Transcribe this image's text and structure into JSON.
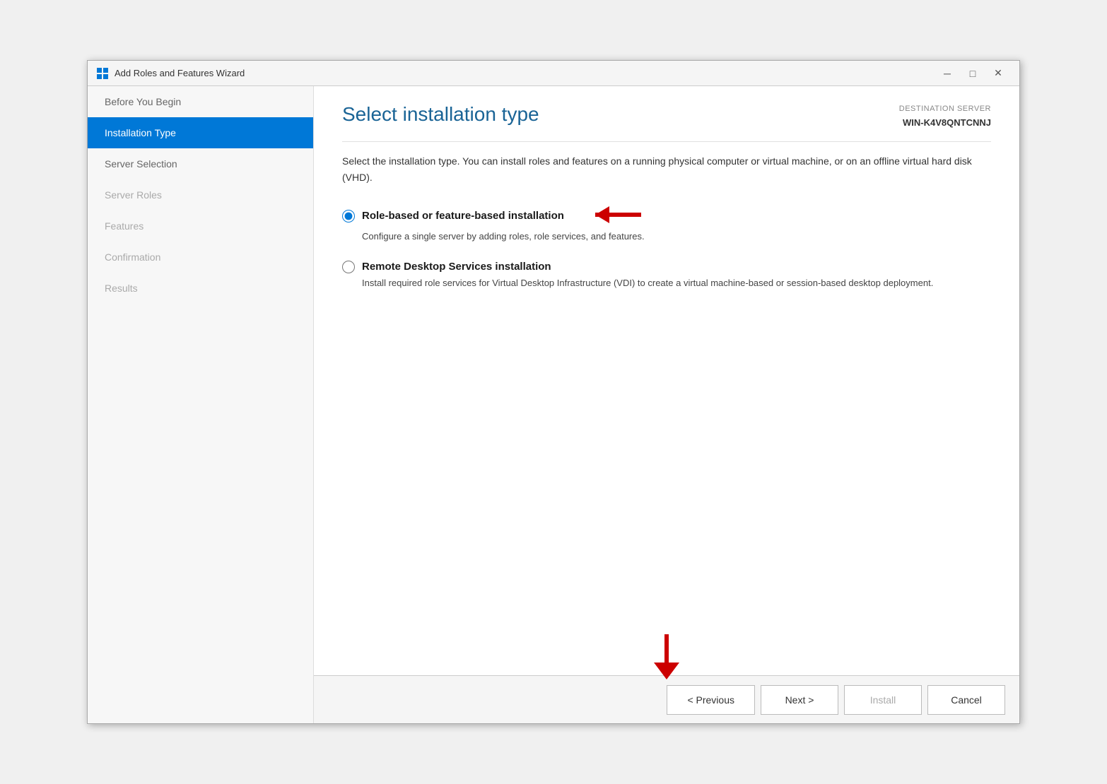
{
  "window": {
    "title": "Add Roles and Features Wizard",
    "minimize_label": "─",
    "maximize_label": "□",
    "close_label": "✕"
  },
  "header": {
    "page_title": "Select installation type",
    "destination_label": "DESTINATION SERVER",
    "destination_name": "WIN-K4V8QNTCNNJ"
  },
  "sidebar": {
    "items": [
      {
        "id": "before-you-begin",
        "label": "Before You Begin",
        "state": "normal"
      },
      {
        "id": "installation-type",
        "label": "Installation Type",
        "state": "active"
      },
      {
        "id": "server-selection",
        "label": "Server Selection",
        "state": "normal"
      },
      {
        "id": "server-roles",
        "label": "Server Roles",
        "state": "inactive"
      },
      {
        "id": "features",
        "label": "Features",
        "state": "inactive"
      },
      {
        "id": "confirmation",
        "label": "Confirmation",
        "state": "inactive"
      },
      {
        "id": "results",
        "label": "Results",
        "state": "inactive"
      }
    ]
  },
  "main": {
    "description": "Select the installation type. You can install roles and features on a running physical computer or virtual machine, or on an offline virtual hard disk (VHD).",
    "options": [
      {
        "id": "role-based",
        "label": "Role-based or feature-based installation",
        "description": "Configure a single server by adding roles, role services, and features.",
        "selected": true
      },
      {
        "id": "remote-desktop",
        "label": "Remote Desktop Services installation",
        "description": "Install required role services for Virtual Desktop Infrastructure (VDI) to create a virtual machine-based or session-based desktop deployment.",
        "selected": false
      }
    ]
  },
  "footer": {
    "previous_label": "< Previous",
    "next_label": "Next >",
    "install_label": "Install",
    "cancel_label": "Cancel"
  }
}
